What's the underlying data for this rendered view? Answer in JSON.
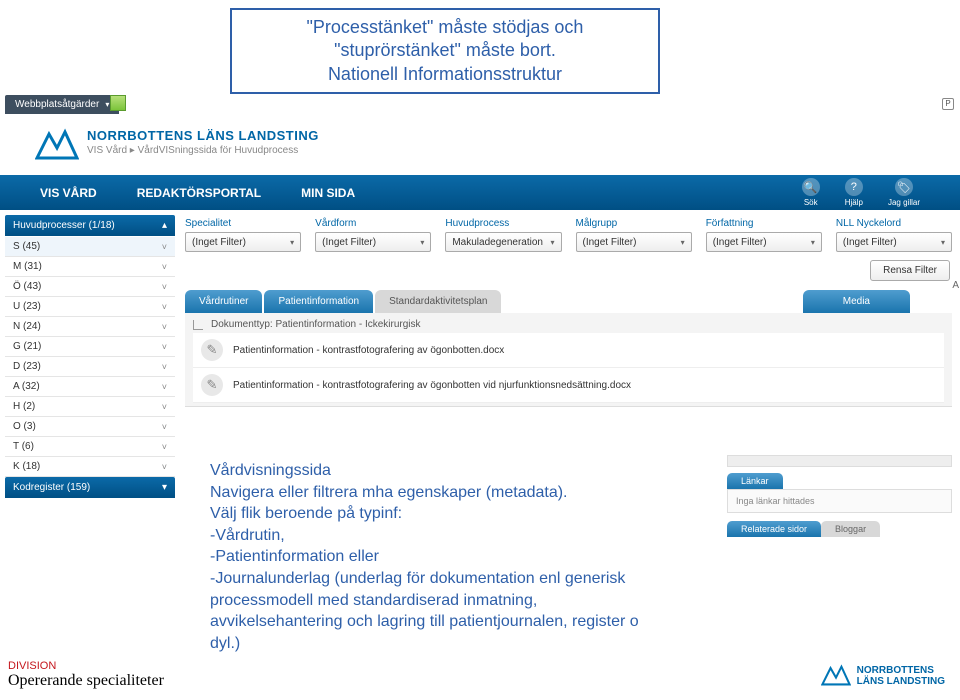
{
  "callout": {
    "line1": "\"Processtänket\" måste stödjas och \"stuprörstänket\" måste bort.",
    "line2": "Nationell Informationsstruktur"
  },
  "webbar": {
    "label": "Webbplatsåtgärder"
  },
  "brand": {
    "name": "NORRBOTTENS LÄNS LANDSTING",
    "sub": "VIS Vård ▸ VårdVISningssida för Huvudprocess"
  },
  "topnav": {
    "items": [
      "VIS VÅRD",
      "REDAKTÖRSPORTAL",
      "MIN SIDA"
    ],
    "right": [
      {
        "icon": "🔍",
        "label": "Sök"
      },
      {
        "icon": "?",
        "label": "Hjälp"
      },
      {
        "icon": "🏷",
        "label": "Jag gillar"
      }
    ]
  },
  "filters": [
    {
      "label": "Specialitet",
      "value": "(Inget Filter)"
    },
    {
      "label": "Vårdform",
      "value": "(Inget Filter)"
    },
    {
      "label": "Huvudprocess",
      "value": "Makuladegeneration"
    },
    {
      "label": "Målgrupp",
      "value": "(Inget Filter)"
    },
    {
      "label": "Författning",
      "value": "(Inget Filter)"
    },
    {
      "label": "NLL Nyckelord",
      "value": "(Inget Filter)"
    }
  ],
  "clearbtn": "Rensa Filter",
  "sidebar": {
    "head": "Huvudprocesser (1/18)",
    "items": [
      "S (45)",
      "M (31)",
      "Ö (43)",
      "U (23)",
      "N (24)",
      "G (21)",
      "D (23)",
      "A (32)",
      "H (2)",
      "O (3)",
      "T (6)",
      "K (18)"
    ],
    "foot": "Kodregister (159)"
  },
  "tabs": {
    "a": "Vårdrutiner",
    "b": "Patientinformation",
    "c": "Standardaktivitetsplan",
    "media": "Media"
  },
  "docs": {
    "head": "Dokumenttyp: Patientinformation - Ickekirurgisk",
    "rows": [
      "Patientinformation - kontrastfotografering av ögonbotten.docx",
      "Patientinformation - kontrastfotografering av ögonbotten vid njurfunktionsnedsättning.docx"
    ]
  },
  "note": {
    "t1": "Vårdvisningssida",
    "t2": "Navigera eller filtrera mha egenskaper (metadata).",
    "t3": "Välj flik beroende på typinf:",
    "t4": "-Vårdrutin,",
    "t5": "-Patientinformation eller",
    "t6": "-Journalunderlag (underlag för dokumentation enl generisk processmodell med standardiserad inmatning, avvikelsehantering och lagring till patientjournalen, register o dyl.)"
  },
  "widgets": {
    "w1": {
      "tab": "Länkar",
      "body": "Inga länkar hittades"
    },
    "w2": {
      "taba": "Relaterade sidor",
      "tabb": "Bloggar"
    }
  },
  "footer": {
    "div": "DIVISION",
    "name": "Opererande specialiteter",
    "brand": "NORRBOTTENS\nLÄNS LANDSTING"
  },
  "abadge": "A",
  "pbadge": "P"
}
